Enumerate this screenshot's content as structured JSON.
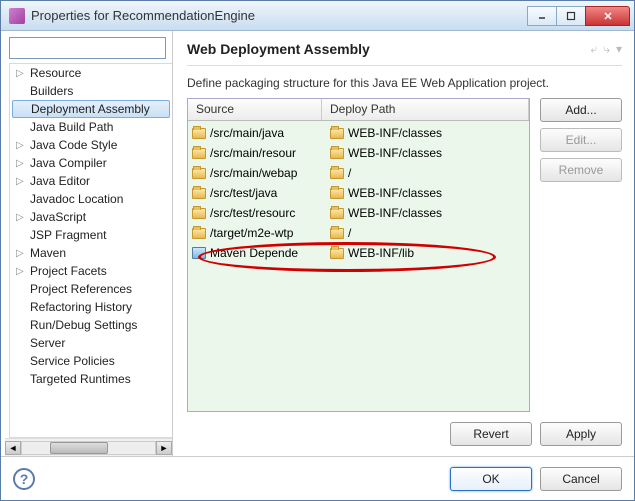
{
  "window": {
    "title": "Properties for RecommendationEngine"
  },
  "sidebar": {
    "filter_placeholder": "",
    "items": [
      {
        "label": "Resource",
        "expandable": true
      },
      {
        "label": "Builders",
        "expandable": false
      },
      {
        "label": "Deployment Assembly",
        "expandable": false,
        "selected": true
      },
      {
        "label": "Java Build Path",
        "expandable": false
      },
      {
        "label": "Java Code Style",
        "expandable": true
      },
      {
        "label": "Java Compiler",
        "expandable": true
      },
      {
        "label": "Java Editor",
        "expandable": true
      },
      {
        "label": "Javadoc Location",
        "expandable": false
      },
      {
        "label": "JavaScript",
        "expandable": true
      },
      {
        "label": "JSP Fragment",
        "expandable": false
      },
      {
        "label": "Maven",
        "expandable": true
      },
      {
        "label": "Project Facets",
        "expandable": true
      },
      {
        "label": "Project References",
        "expandable": false
      },
      {
        "label": "Refactoring History",
        "expandable": false
      },
      {
        "label": "Run/Debug Settings",
        "expandable": false
      },
      {
        "label": "Server",
        "expandable": false
      },
      {
        "label": "Service Policies",
        "expandable": false
      },
      {
        "label": "Targeted Runtimes",
        "expandable": false
      }
    ]
  },
  "main": {
    "title": "Web Deployment Assembly",
    "description": "Define packaging structure for this Java EE Web Application project.",
    "columns": {
      "source": "Source",
      "deploy": "Deploy Path"
    },
    "rows": [
      {
        "icon": "folder",
        "source": "/src/main/java",
        "deploy_icon": "folder",
        "deploy": "WEB-INF/classes"
      },
      {
        "icon": "folder",
        "source": "/src/main/resour",
        "deploy_icon": "folder",
        "deploy": "WEB-INF/classes"
      },
      {
        "icon": "folder",
        "source": "/src/main/webap",
        "deploy_icon": "folder",
        "deploy": "/"
      },
      {
        "icon": "folder",
        "source": "/src/test/java",
        "deploy_icon": "folder",
        "deploy": "WEB-INF/classes"
      },
      {
        "icon": "folder",
        "source": "/src/test/resourc",
        "deploy_icon": "folder",
        "deploy": "WEB-INF/classes"
      },
      {
        "icon": "folder",
        "source": "/target/m2e-wtp",
        "deploy_icon": "folder",
        "deploy": "/"
      },
      {
        "icon": "jar",
        "source": "Maven Depende",
        "deploy_icon": "folder",
        "deploy": "WEB-INF/lib"
      }
    ],
    "buttons": {
      "add": "Add...",
      "edit": "Edit...",
      "remove": "Remove",
      "revert": "Revert",
      "apply": "Apply"
    }
  },
  "footer": {
    "ok": "OK",
    "cancel": "Cancel"
  }
}
